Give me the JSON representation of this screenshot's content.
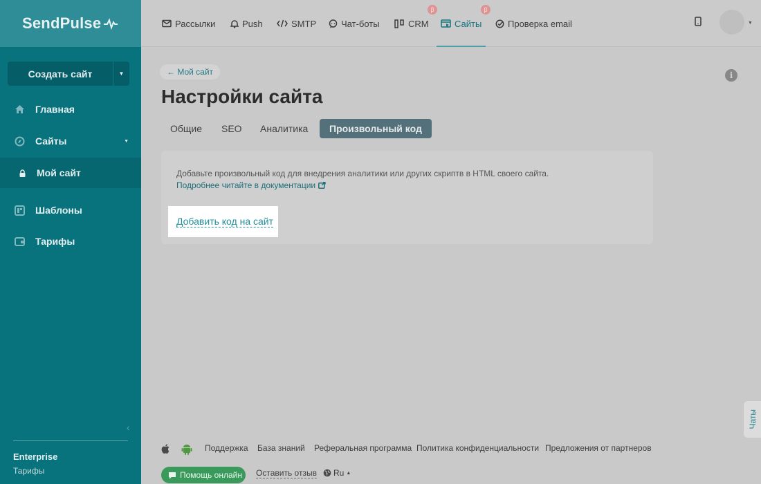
{
  "sidebar": {
    "logo": "SendPulse",
    "create_button": "Создать сайт",
    "items": [
      {
        "label": "Главная",
        "icon": "home-icon"
      },
      {
        "label": "Сайты",
        "icon": "sites-icon"
      },
      {
        "label": "Мой сайт",
        "icon": "lock-icon"
      },
      {
        "label": "Шаблоны",
        "icon": "templates-icon"
      },
      {
        "label": "Тарифы",
        "icon": "wallet-icon"
      }
    ],
    "plan_name": "Enterprise",
    "plan_link": "Тарифы"
  },
  "topnav": {
    "items": [
      {
        "label": "Рассылки",
        "icon": "mail-icon"
      },
      {
        "label": "Push",
        "icon": "bell-icon"
      },
      {
        "label": "SMTP",
        "icon": "code-icon"
      },
      {
        "label": "Чат-боты",
        "icon": "chat-icon"
      },
      {
        "label": "CRM",
        "icon": "crm-icon",
        "badge": "β"
      },
      {
        "label": "Сайты",
        "icon": "sites-nav-icon",
        "badge": "β",
        "active": true
      },
      {
        "label": "Проверка email",
        "icon": "check-icon"
      }
    ]
  },
  "main": {
    "back_link": "← Мой сайт",
    "title": "Настройки сайта",
    "tabs": [
      {
        "label": "Общие"
      },
      {
        "label": "SEO"
      },
      {
        "label": "Аналитика"
      },
      {
        "label": "Произвольный код",
        "active": true
      }
    ],
    "card": {
      "description": "Добавьте произвольный код для внедрения аналитики или других скриптв в HTML своего сайта.",
      "docs_link": "Подробнее читайте в документации",
      "add_code_link": "Добавить код на сайт"
    }
  },
  "footer": {
    "links": [
      "Поддержка",
      "База знаний",
      "Реферальная программа",
      "Политика конфиденциальности",
      "Предложения от партнеров"
    ],
    "help_button": "Помощь онлайн",
    "review_link": "Оставить отзыв",
    "language": "Ru"
  },
  "chats_tab": "Чаты",
  "colors": {
    "sidebar": "#09737d",
    "accent": "#1f8f9b",
    "active_tab": "#54707a",
    "help_button": "#3a9a5b"
  }
}
